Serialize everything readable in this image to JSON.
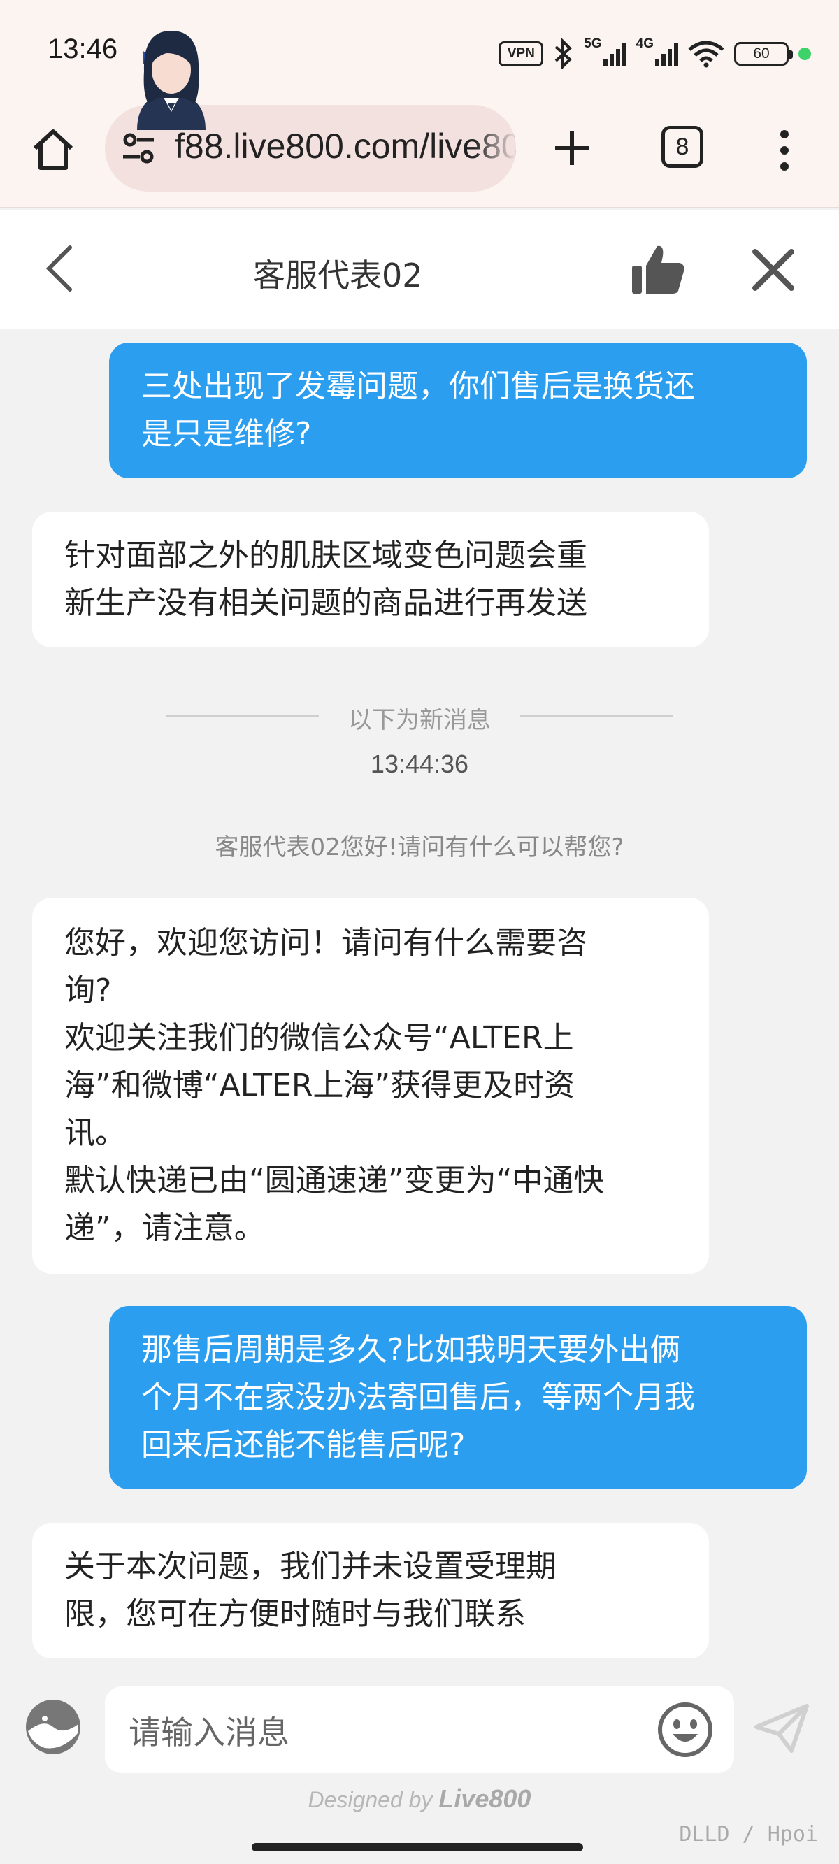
{
  "status_bar": {
    "time": "13:46",
    "vpn": "VPN",
    "net1": "5G",
    "net2": "4G",
    "battery": "60"
  },
  "browser": {
    "url": "f88.live800.com/live800",
    "tab_count": "8"
  },
  "chat_header": {
    "agent_name": "客服代表02"
  },
  "messages": [
    {
      "role": "user",
      "lines": [
        "三处出现了发霉问题，你们售后是换货还",
        "是只是维修?"
      ]
    },
    {
      "role": "agent",
      "lines": [
        "针对面部之外的肌肤区域变色问题会重",
        "新生产没有相关问题的商品进行再发送"
      ]
    },
    {
      "role": "agent",
      "lines": [
        "您好，欢迎您访问！请问有什么需要咨",
        "询?",
        "欢迎关注我们的微信公众号“ALTER上",
        "海”和微博“ALTER上海”获得更及时资",
        "讯。",
        "默认快递已由“圆通速递”变更为“中通快",
        "递”，请注意。"
      ]
    },
    {
      "role": "user",
      "lines": [
        "那售后周期是多久?比如我明天要外出俩",
        "个月不在家没办法寄回售后，等两个月我",
        "回来后还能不能售后呢?"
      ]
    },
    {
      "role": "agent",
      "lines": [
        "关于本次问题，我们并未设置受理期",
        "限，您可在方便时随时与我们联系"
      ]
    }
  ],
  "divider_text": "以下为新消息",
  "timestamp": "13:44:36",
  "system_greeting": "客服代表02您好!请问有什么可以帮您?",
  "input": {
    "placeholder": "请输入消息"
  },
  "footer": {
    "designed_by": "Designed by",
    "brand": "Live800"
  },
  "watermark": "DLLD / Hpoi",
  "colors": {
    "user_bubble": "#2b9ef0",
    "agent_bubble": "#ffffff",
    "background": "#f2f2f2",
    "header_bg": "#fbf4f1"
  },
  "icons": [
    "home-icon",
    "tune-icon",
    "plus-icon",
    "tabs-icon",
    "more-vert-icon",
    "back-icon",
    "thumbs-up-icon",
    "close-icon",
    "emoji-icon",
    "send-icon"
  ]
}
